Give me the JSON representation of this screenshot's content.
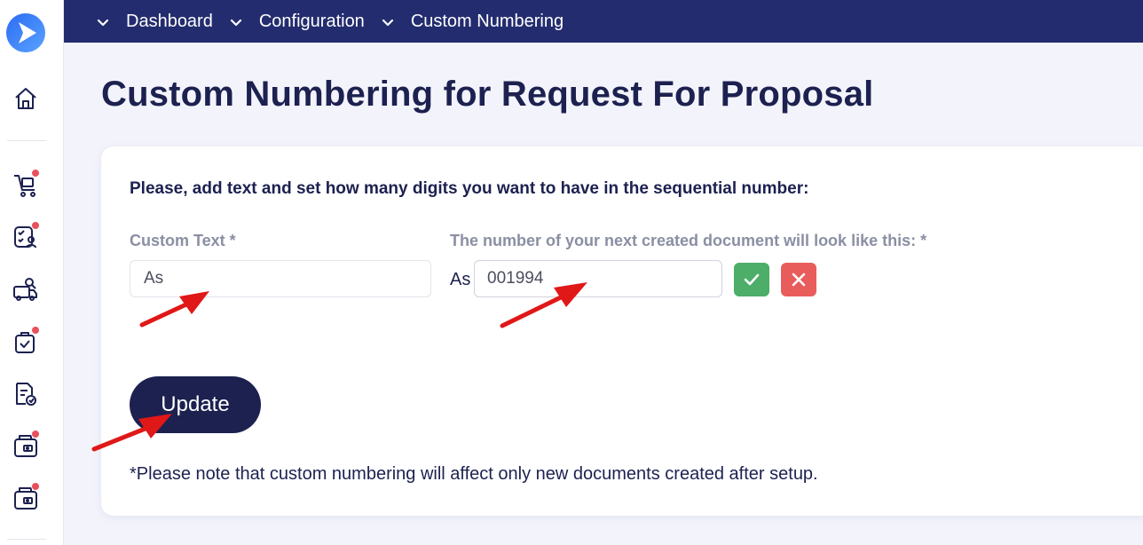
{
  "breadcrumb": {
    "items": [
      {
        "label": "Dashboard"
      },
      {
        "label": "Configuration"
      },
      {
        "label": "Custom Numbering"
      }
    ]
  },
  "page": {
    "title": "Custom Numbering for Request For Proposal"
  },
  "form": {
    "instruction": "Please, add text and set how many digits you want to have in the sequential number:",
    "custom_text_label": "Custom Text *",
    "custom_text_value": "As",
    "preview_label": "The number of your next created document will look like this: *",
    "preview_prefix": "As",
    "preview_number": "001994",
    "update_label": "Update",
    "note": "*Please note that custom numbering will affect only new documents created after setup."
  },
  "sidebar": {
    "icons": [
      {
        "name": "home-icon",
        "badge": false
      },
      {
        "name": "cart-icon",
        "badge": true
      },
      {
        "name": "requisition-icon",
        "badge": true
      },
      {
        "name": "supplier-search-icon",
        "badge": false
      },
      {
        "name": "approval-bag-icon",
        "badge": true
      },
      {
        "name": "document-check-icon",
        "badge": false
      },
      {
        "name": "wallet-icon",
        "badge": true
      },
      {
        "name": "payment-icon",
        "badge": true
      }
    ]
  },
  "colors": {
    "topbar": "#232c6e",
    "primary": "#1c2150",
    "confirm": "#4cae68",
    "cancel": "#e95c5c",
    "badge": "#e8505b",
    "annotation_arrow": "#e01818"
  }
}
